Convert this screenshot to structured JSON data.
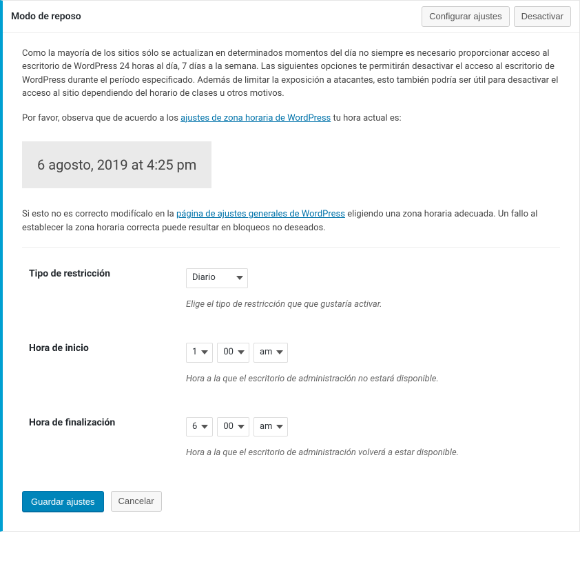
{
  "header": {
    "title": "Modo de reposo",
    "configure_label": "Configurar ajustes",
    "deactivate_label": "Desactivar"
  },
  "body": {
    "intro": "Como la mayoría de los sitios sólo se actualizan en determinados momentos del día no siempre es necesario proporcionar acceso al escritorio de WordPress 24 horas al día, 7 días a la semana. Las siguientes opciones te permitirán desactivar el acceso al escritorio de WordPress durante el período especificado. Además de limitar la exposición a atacantes, esto también podría ser útil para desactivar el acceso al sitio dependiendo del horario de clases u otros motivos.",
    "note_prefix": "Por favor, observa que de acuerdo a los ",
    "note_link": "ajustes de zona horaria de WordPress",
    "note_suffix": " tu hora actual es:",
    "current_time": "6 agosto, 2019 at 4:25 pm",
    "note2_prefix": "Si esto no es correcto modifícalo en la ",
    "note2_link": "página de ajustes generales de WordPress",
    "note2_suffix": " eligiendo una zona horaria adecuada. Un fallo al establecer la zona horaria correcta puede resultar en bloqueos no deseados."
  },
  "form": {
    "restriction_type": {
      "label": "Tipo de restricción",
      "value": "Diario",
      "help": "Elige el tipo de restricción que que gustaría activar."
    },
    "start_time": {
      "label": "Hora de inicio",
      "hour": "1",
      "minute": "00",
      "ampm": "am",
      "help": "Hora a la que el escritorio de administración no estará disponible."
    },
    "end_time": {
      "label": "Hora de finalización",
      "hour": "6",
      "minute": "00",
      "ampm": "am",
      "help": "Hora a la que el escritorio de administración volverá a estar disponible."
    },
    "save_label": "Guardar ajustes",
    "cancel_label": "Cancelar"
  }
}
